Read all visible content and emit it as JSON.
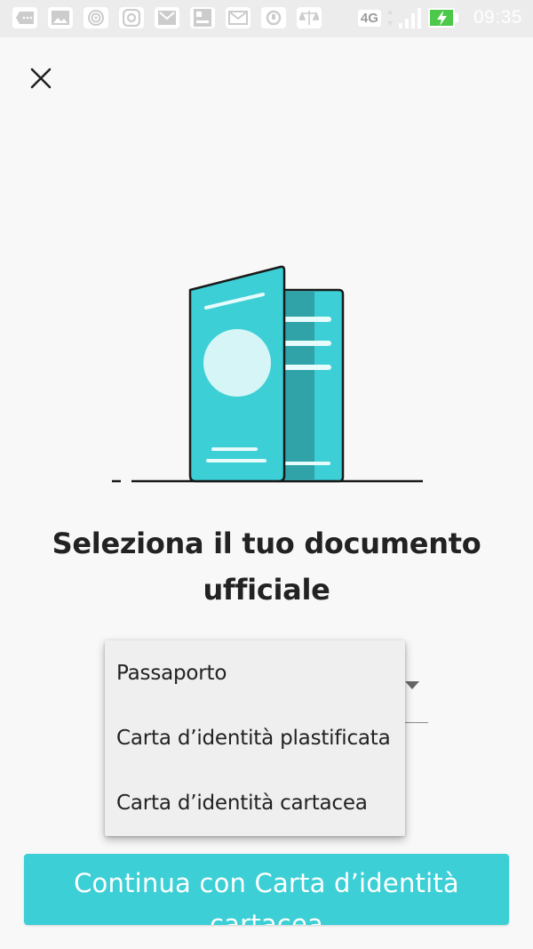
{
  "status_bar": {
    "network": "4G",
    "time": "09:35",
    "icons": [
      "message-icon",
      "gallery-icon",
      "hotspot-icon",
      "instagram-icon",
      "gmail-icon",
      "news-icon",
      "mail-icon",
      "sync-icon",
      "scales-icon",
      "signal-icon",
      "battery-charging-icon"
    ]
  },
  "header": {
    "close_icon": "close-icon"
  },
  "illustration": {
    "name": "id-documents-illustration",
    "colors": {
      "accent": "#3ccfd6",
      "accent_dark": "#2fa3a8",
      "circle": "#d5f5f6",
      "outline": "#1a1a1a"
    }
  },
  "main": {
    "title": "Seleziona il tuo documento ufficiale"
  },
  "document_select": {
    "options": [
      "Passaporto",
      "Carta d’identità plastificata",
      "Carta d’identità cartacea"
    ]
  },
  "footer": {
    "continue_label": "Continua con Carta d’identità cartacea",
    "button_color": "#3ccfd6"
  }
}
